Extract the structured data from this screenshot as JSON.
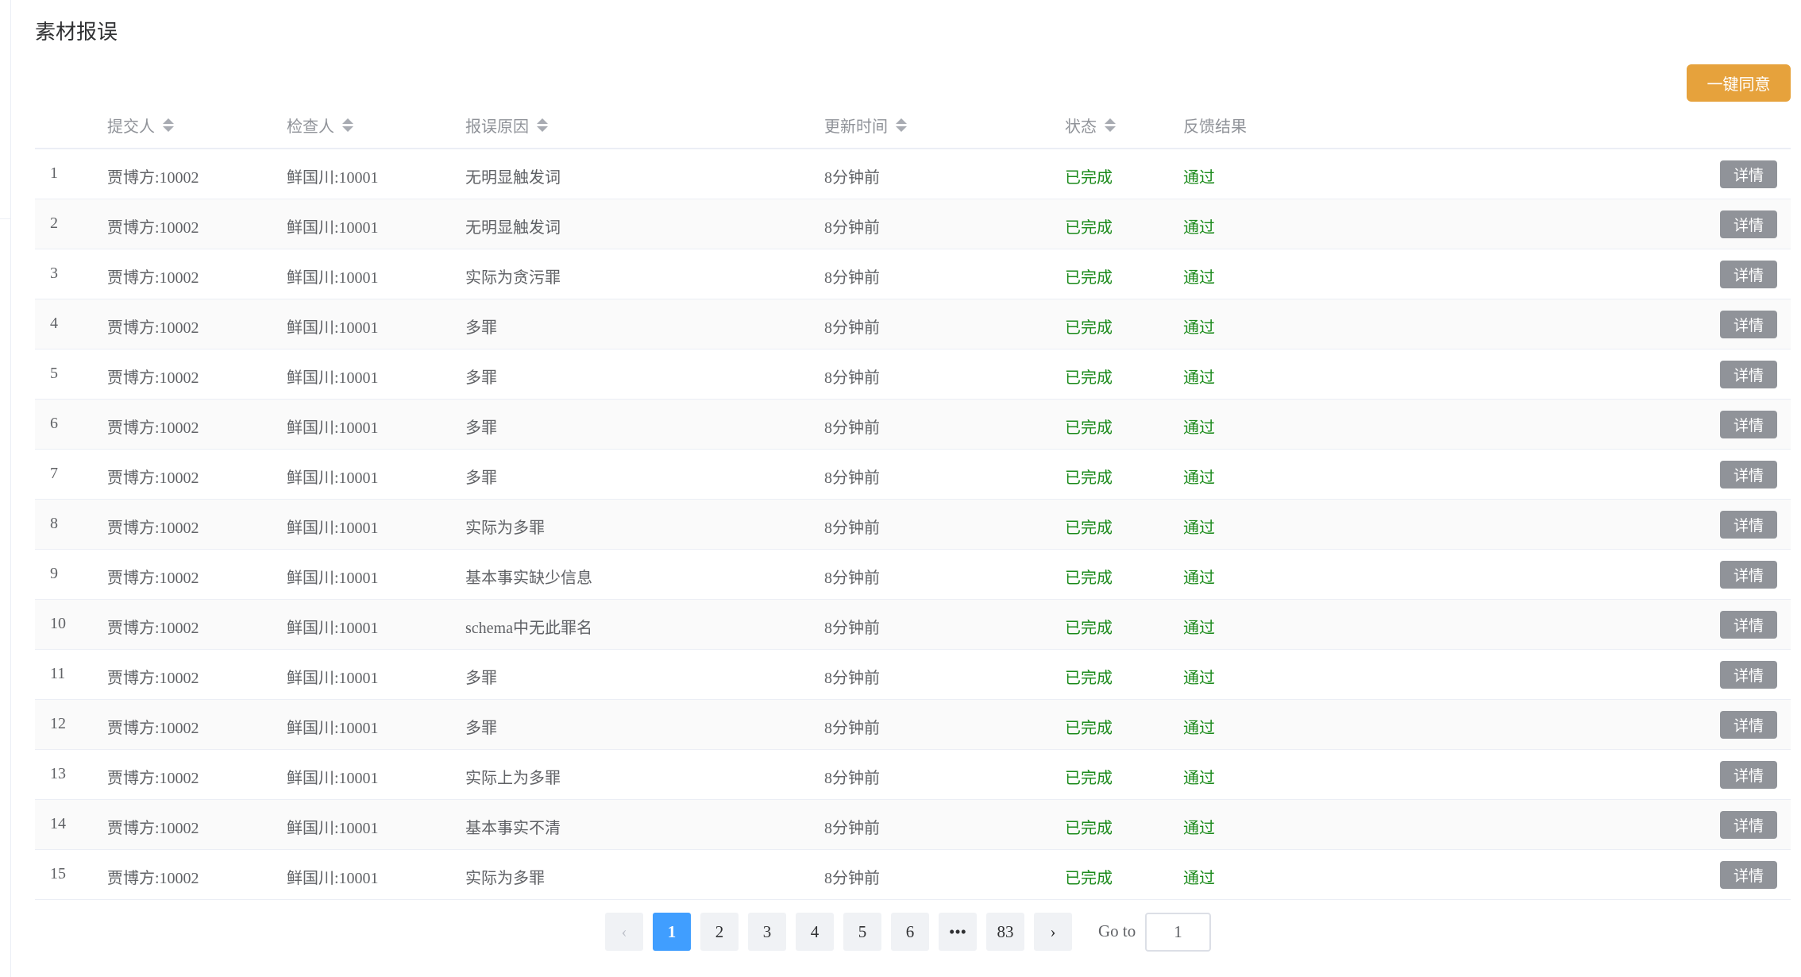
{
  "page_title": "素材报误",
  "agree_all_label": "一键同意",
  "columns": {
    "submitter": "提交人",
    "checker": "检查人",
    "reason": "报误原因",
    "updated": "更新时间",
    "status": "状态",
    "feedback": "反馈结果"
  },
  "detail_label": "详情",
  "colors": {
    "accent": "#e6a23c",
    "status_green": "#1a8a1a",
    "active_page": "#409eff",
    "detail_button": "#909399"
  },
  "rows": [
    {
      "index": "1",
      "submitter": "贾博方:10002",
      "checker": "鲜国川:10001",
      "reason": "无明显触发词",
      "updated": "8分钟前",
      "status": "已完成",
      "feedback": "通过"
    },
    {
      "index": "2",
      "submitter": "贾博方:10002",
      "checker": "鲜国川:10001",
      "reason": "无明显触发词",
      "updated": "8分钟前",
      "status": "已完成",
      "feedback": "通过"
    },
    {
      "index": "3",
      "submitter": "贾博方:10002",
      "checker": "鲜国川:10001",
      "reason": "实际为贪污罪",
      "updated": "8分钟前",
      "status": "已完成",
      "feedback": "通过"
    },
    {
      "index": "4",
      "submitter": "贾博方:10002",
      "checker": "鲜国川:10001",
      "reason": "多罪",
      "updated": "8分钟前",
      "status": "已完成",
      "feedback": "通过"
    },
    {
      "index": "5",
      "submitter": "贾博方:10002",
      "checker": "鲜国川:10001",
      "reason": "多罪",
      "updated": "8分钟前",
      "status": "已完成",
      "feedback": "通过"
    },
    {
      "index": "6",
      "submitter": "贾博方:10002",
      "checker": "鲜国川:10001",
      "reason": "多罪",
      "updated": "8分钟前",
      "status": "已完成",
      "feedback": "通过"
    },
    {
      "index": "7",
      "submitter": "贾博方:10002",
      "checker": "鲜国川:10001",
      "reason": "多罪",
      "updated": "8分钟前",
      "status": "已完成",
      "feedback": "通过"
    },
    {
      "index": "8",
      "submitter": "贾博方:10002",
      "checker": "鲜国川:10001",
      "reason": "实际为多罪",
      "updated": "8分钟前",
      "status": "已完成",
      "feedback": "通过"
    },
    {
      "index": "9",
      "submitter": "贾博方:10002",
      "checker": "鲜国川:10001",
      "reason": "基本事实缺少信息",
      "updated": "8分钟前",
      "status": "已完成",
      "feedback": "通过"
    },
    {
      "index": "10",
      "submitter": "贾博方:10002",
      "checker": "鲜国川:10001",
      "reason": "schema中无此罪名",
      "updated": "8分钟前",
      "status": "已完成",
      "feedback": "通过"
    },
    {
      "index": "11",
      "submitter": "贾博方:10002",
      "checker": "鲜国川:10001",
      "reason": "多罪",
      "updated": "8分钟前",
      "status": "已完成",
      "feedback": "通过"
    },
    {
      "index": "12",
      "submitter": "贾博方:10002",
      "checker": "鲜国川:10001",
      "reason": "多罪",
      "updated": "8分钟前",
      "status": "已完成",
      "feedback": "通过"
    },
    {
      "index": "13",
      "submitter": "贾博方:10002",
      "checker": "鲜国川:10001",
      "reason": "实际上为多罪",
      "updated": "8分钟前",
      "status": "已完成",
      "feedback": "通过"
    },
    {
      "index": "14",
      "submitter": "贾博方:10002",
      "checker": "鲜国川:10001",
      "reason": "基本事实不清",
      "updated": "8分钟前",
      "status": "已完成",
      "feedback": "通过"
    },
    {
      "index": "15",
      "submitter": "贾博方:10002",
      "checker": "鲜国川:10001",
      "reason": "实际为多罪",
      "updated": "8分钟前",
      "status": "已完成",
      "feedback": "通过"
    }
  ],
  "pagination": {
    "prev": "‹",
    "pages": [
      "1",
      "2",
      "3",
      "4",
      "5",
      "6",
      "•••",
      "83"
    ],
    "current": "1",
    "next": "›",
    "goto_label": "Go to",
    "goto_value": "1"
  }
}
